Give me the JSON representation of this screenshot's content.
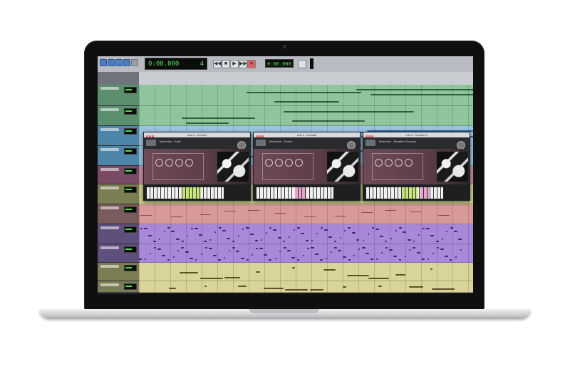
{
  "transport": {
    "main_counter": "0:00.000",
    "main_counter_extra": "4",
    "secondary_counter": "0:00.000"
  },
  "plugins": [
    {
      "title": "Inst 1 - Kontakt",
      "name": "Maschine - Knife",
      "keys_highlight": "green"
    },
    {
      "title": "Inst 2 - Kontakt",
      "name": "Maschine - Drums",
      "keys_highlight": "pink"
    },
    {
      "title": "Inst 3 - Kontakt 4",
      "name": "Maschine - Bassline Grooves",
      "keys_highlight": "green"
    }
  ],
  "tracks": [
    {
      "color": "#5b8f6e",
      "lane": "#8fc59d"
    },
    {
      "color": "#5b8f6e",
      "lane": "#8fc59d"
    },
    {
      "color": "#4d86a8",
      "lane": "#9cc4e0"
    },
    {
      "color": "#4d86a8",
      "lane": "#9cc4e0"
    },
    {
      "color": "#7a4a66",
      "lane": "#c98aa0"
    },
    {
      "color": "#7b7d52",
      "lane": "#cfcf8d"
    },
    {
      "color": "#7a5a5a",
      "lane": "#d79a98"
    },
    {
      "color": "#5e4f7d",
      "lane": "#a889d9"
    },
    {
      "color": "#5e4f7d",
      "lane": "#a889d9"
    },
    {
      "color": "#7b7d52",
      "lane": "#d8d49a"
    },
    {
      "color": "#7b7d52",
      "lane": "#d8d49a"
    }
  ]
}
